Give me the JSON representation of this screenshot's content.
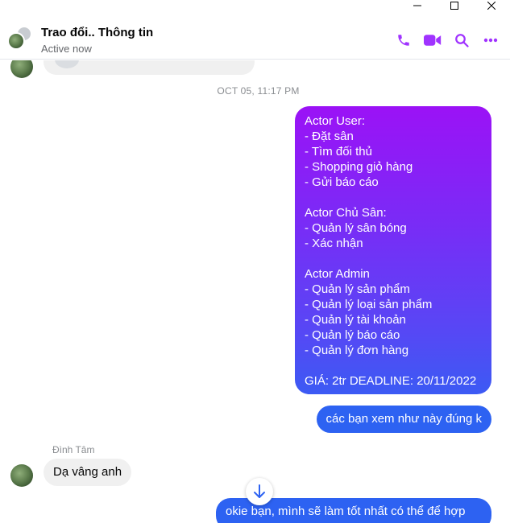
{
  "window": {
    "controls": [
      "minimize",
      "maximize",
      "close"
    ]
  },
  "header": {
    "title": "Trao đổi.. Thông tin",
    "status": "Active now",
    "icons": [
      "phone-icon",
      "video-icon",
      "search-icon",
      "more-icon"
    ],
    "accent_color": "#a033ff"
  },
  "conversation": {
    "timestamp": "OCT 05, 11:17 PM",
    "messages": [
      {
        "from": "me",
        "text": "Actor User:\n- Đặt sân\n- Tìm đối thủ\n- Shopping giỏ hàng\n- Gửi báo cáo\n\nActor Chủ Sân:\n- Quản lý sân bóng\n- Xác nhận\n\nActor Admin\n- Quản lý sản phẩm\n- Quản lý loại sản phẩm\n- Quản lý tài khoản\n- Quản lý báo cáo\n- Quản lý đơn hàng\n\nGIÁ: 2tr DEADLINE: 20/11/2022"
      },
      {
        "from": "me",
        "text": "các bạn xem như này đúng k"
      },
      {
        "from": "other",
        "sender": "Đình Tâm",
        "text": "Dạ vâng anh"
      },
      {
        "from": "me",
        "text": "okie bạn, mình sẽ làm tốt nhất có thể để hợp"
      }
    ],
    "outgoing_color": "#2d62f2",
    "incoming_color": "#f0f0f0"
  }
}
